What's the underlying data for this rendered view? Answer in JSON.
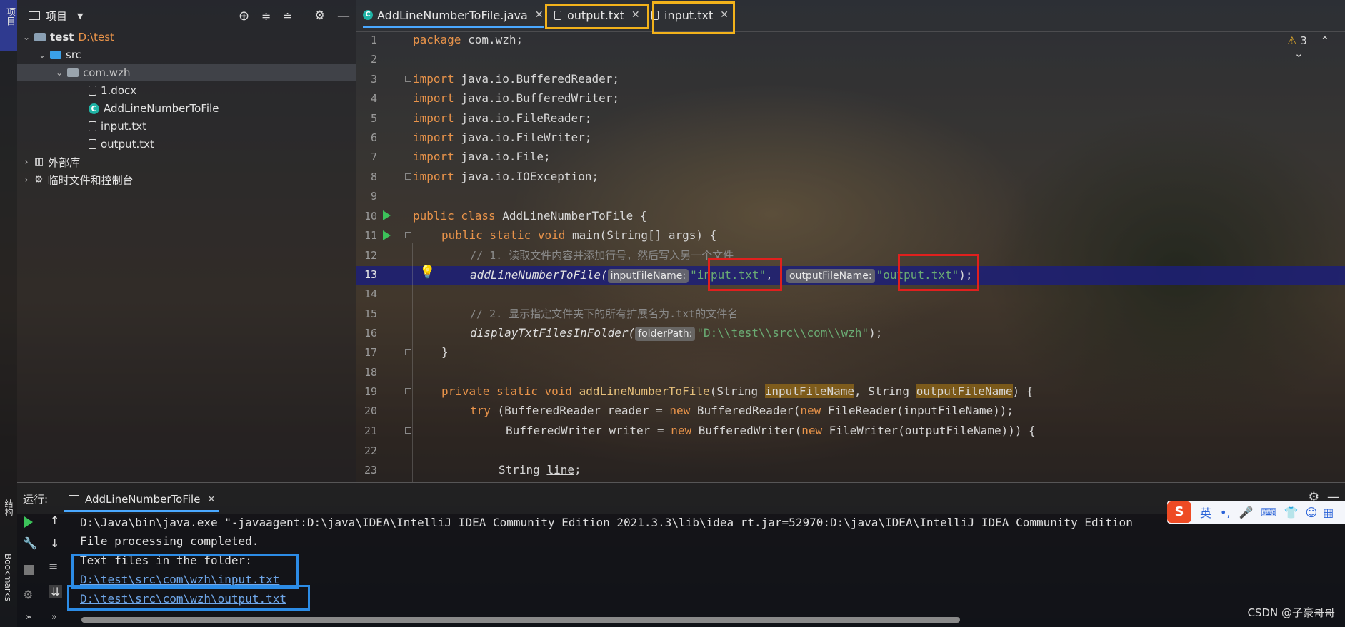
{
  "left_strip": {
    "project_label": "项目",
    "structure_label": "结构",
    "bookmarks_label": "Bookmarks"
  },
  "project": {
    "title": "项目",
    "tree": [
      {
        "label": "test",
        "extra": "D:\\test"
      },
      {
        "label": "src"
      },
      {
        "label": "com.wzh"
      },
      {
        "label": "1.docx"
      },
      {
        "label": "AddLineNumberToFile"
      },
      {
        "label": "input.txt"
      },
      {
        "label": "output.txt"
      },
      {
        "label": "外部库"
      },
      {
        "label": "临时文件和控制台"
      }
    ]
  },
  "tabs": [
    {
      "label": "AddLineNumberToFile.java"
    },
    {
      "label": "output.txt"
    },
    {
      "label": "input.txt"
    }
  ],
  "editor": {
    "warning_count": "3",
    "line_numbers": [
      "1",
      "2",
      "3",
      "4",
      "5",
      "6",
      "7",
      "8",
      "9",
      "10",
      "11",
      "12",
      "13",
      "14",
      "15",
      "16",
      "17",
      "18",
      "19",
      "20",
      "21",
      "22",
      "23"
    ],
    "code": {
      "l1_kw": "package",
      "l1_rest": " com.wzh;",
      "l3_kw": "import",
      "l3_rest": " java.io.BufferedReader;",
      "l4_kw": "import",
      "l4_rest": " java.io.BufferedWriter;",
      "l5_kw": "import",
      "l5_rest": " java.io.FileReader;",
      "l6_kw": "import",
      "l6_rest": " java.io.FileWriter;",
      "l7_kw": "import",
      "l7_rest": " java.io.File;",
      "l8_kw": "import",
      "l8_rest": " java.io.IOException;",
      "l10_kw": "public class",
      "l10_rest": " AddLineNumberToFile {",
      "l11_kw": "public static void",
      "l11_rest": " main(String[] args) {",
      "l12": "// 1. 读取文件内容并添加行号，然后写入另一个文件",
      "l13_fn": "addLineNumberToFile(",
      "l13_hint1": "inputFileName:",
      "l13_str1": "\"input.txt\"",
      "l13_sep": ", ",
      "l13_hint2": "outputFileName:",
      "l13_str2": "\"output.txt\"",
      "l13_end": ");",
      "l15": "// 2. 显示指定文件夹下的所有扩展名为.txt的文件名",
      "l16_fn": "displayTxtFilesInFolder(",
      "l16_hint": "folderPath:",
      "l16_str": "\"D:\\\\test\\\\src\\\\com\\\\wzh\"",
      "l16_end": ");",
      "l17": "}",
      "l19_kw": "private static void",
      "l19_fn": " addLineNumberToFile",
      "l19_a": "(String ",
      "l19_p1": "inputFileName",
      "l19_b": ", String ",
      "l19_p2": "outputFileName",
      "l19_c": ") {",
      "l20_kw": "try",
      "l20_a": " (BufferedReader reader = ",
      "l20_new1": "new",
      "l20_b": " BufferedReader(",
      "l20_new2": "new",
      "l20_c": " FileReader(inputFileName));",
      "l21_a": "BufferedWriter writer = ",
      "l21_new1": "new",
      "l21_b": " BufferedWriter(",
      "l21_new2": "new",
      "l21_c": " FileWriter(outputFileName))) {",
      "l23_a": "String ",
      "l23_b": "line",
      "l23_c": ";"
    }
  },
  "run": {
    "label": "运行:",
    "tab": "AddLineNumberToFile",
    "output": [
      "D:\\Java\\bin\\java.exe \"-javaagent:D:\\java\\IDEA\\IntelliJ IDEA Community Edition 2021.3.3\\lib\\idea_rt.jar=52970:D:\\java\\IDEA\\IntelliJ IDEA Community Edition",
      "File processing completed.",
      "Text files in the folder:",
      "D:\\test\\src\\com\\wzh\\input.txt",
      "D:\\test\\src\\com\\wzh\\output.txt"
    ]
  },
  "ime": {
    "lang": "英"
  },
  "watermark": "CSDN @子豪哥哥"
}
